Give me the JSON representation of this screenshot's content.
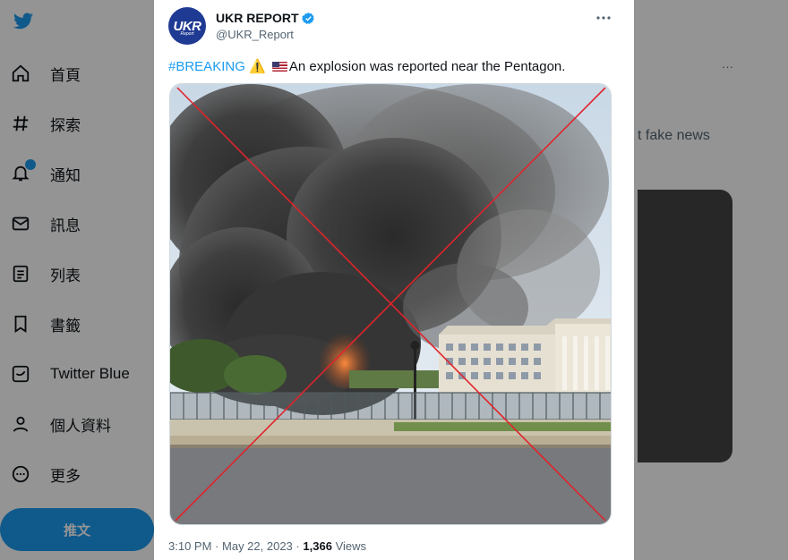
{
  "background_app": {
    "nav_items": [
      {
        "icon": "home-icon",
        "label": "首頁"
      },
      {
        "icon": "hashtag-icon",
        "label": "探索"
      },
      {
        "icon": "bell-icon",
        "label": "通知"
      },
      {
        "icon": "mail-icon",
        "label": "訊息"
      },
      {
        "icon": "list-icon",
        "label": "列表"
      },
      {
        "icon": "bookmark-icon",
        "label": "書籤"
      },
      {
        "icon": "twitter-blue-icon",
        "label": "Twitter Blue"
      },
      {
        "icon": "profile-icon",
        "label": "個人資料"
      },
      {
        "icon": "more-circle-icon",
        "label": "更多"
      }
    ],
    "post_button_label": "推文",
    "right_column_text": "t fake news"
  },
  "tweet": {
    "author": {
      "display_name": "UKR REPORT",
      "handle": "@UKR_Report",
      "verified": true,
      "avatar_text": "UKR",
      "avatar_subtext": "Report",
      "avatar_color": "#1f3a93"
    },
    "text": {
      "hashtag": "#BREAKING",
      "warning_emoji": "⚠️",
      "flag_emoji": "🇺🇸",
      "body": "An explosion was reported near the Pentagon."
    },
    "media": {
      "description_icon": "fake-image-crossed-out",
      "cross_color": "#e0242b"
    },
    "meta": {
      "time": "3:10 PM",
      "separator": "·",
      "date": "May 22, 2023",
      "views_count": "1,366",
      "views_label": "Views"
    }
  },
  "colors": {
    "accent": "#1d9bf0",
    "text_primary": "#0f1419",
    "text_secondary": "#536471",
    "cross": "#e0242b"
  }
}
